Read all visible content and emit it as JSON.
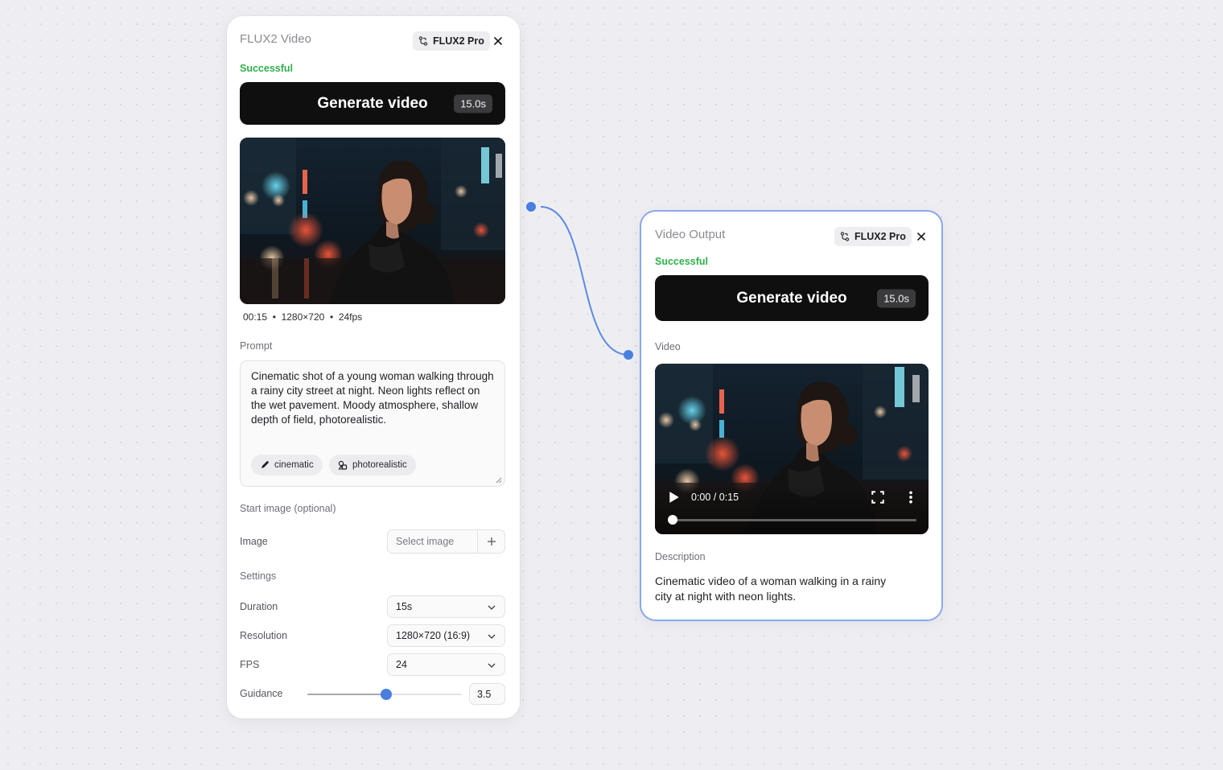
{
  "generate_node": {
    "title": "FLUX2 Video",
    "model_chip": "FLUX2 Pro",
    "status": "Successful",
    "generate_button": "Generate video",
    "generate_time": "15.0s",
    "video_meta": "00:15  •  1280×720  •  24fps",
    "prompt_label": "Prompt",
    "prompt_text": "Cinematic shot of a young woman walking through a rainy city street at night. Neon lights reflect on the wet pavement. Moody atmosphere, shallow depth of field, photorealistic.",
    "tags": [
      {
        "label": "cinematic",
        "icon": "pencil-icon"
      },
      {
        "label": "photorealistic",
        "icon": "shapes-icon"
      }
    ],
    "start_image_label": "Start image (optional)",
    "image_label": "Image",
    "image_placeholder": "Select image",
    "settings_label": "Settings",
    "duration_label": "Duration",
    "duration_value": "15s",
    "resolution_label": "Resolution",
    "resolution_value": "1280×720 (16:9)",
    "fps_label": "FPS",
    "fps_value": "24",
    "guidance_label": "Guidance",
    "guidance_value": "3.5",
    "guidance_fraction": 0.51
  },
  "output_node": {
    "title": "Video Output",
    "model_chip": "FLUX2 Pro",
    "status": "Successful",
    "generate_button": "Generate video",
    "generate_time": "15.0s",
    "video_label": "Video",
    "player_time": "0:00 / 0:15",
    "player_progress": 0,
    "description_label": "Description",
    "description_text": "Cinematic video of a woman walking in a rainy city at night with neon lights."
  },
  "colors": {
    "accent": "#4a7ee0",
    "success": "#2eb04a",
    "button_bg": "#0f0f10"
  }
}
